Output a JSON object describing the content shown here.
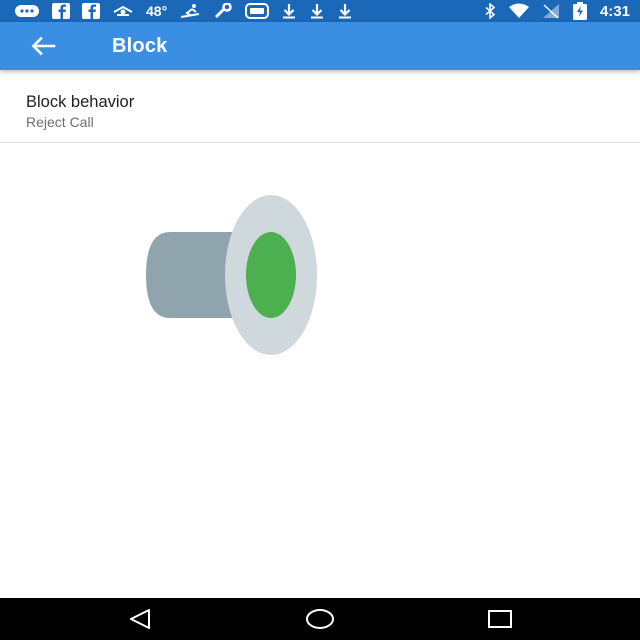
{
  "status_bar": {
    "temperature": "48°",
    "time": "4:31",
    "left_icons": [
      "message-icon",
      "facebook-icon",
      "facebook-icon",
      "weather-icon",
      "temperature-text",
      "ski-icon",
      "wrench-icon",
      "game-icon",
      "download-icon",
      "download-icon",
      "download-icon"
    ],
    "right_icons": [
      "bluetooth-icon",
      "wifi-icon",
      "no-signal-icon",
      "battery-charging-icon"
    ]
  },
  "app_bar": {
    "title": "Block",
    "color": "#3a8fe2"
  },
  "setting": {
    "title": "Block behavior",
    "value": "Reject Call"
  },
  "illustration": {
    "icon": "speaker-icon",
    "accent": "#4caf50"
  },
  "nav_bar": {
    "buttons": [
      "back-triangle-icon",
      "home-circle-icon",
      "recents-square-icon"
    ]
  }
}
